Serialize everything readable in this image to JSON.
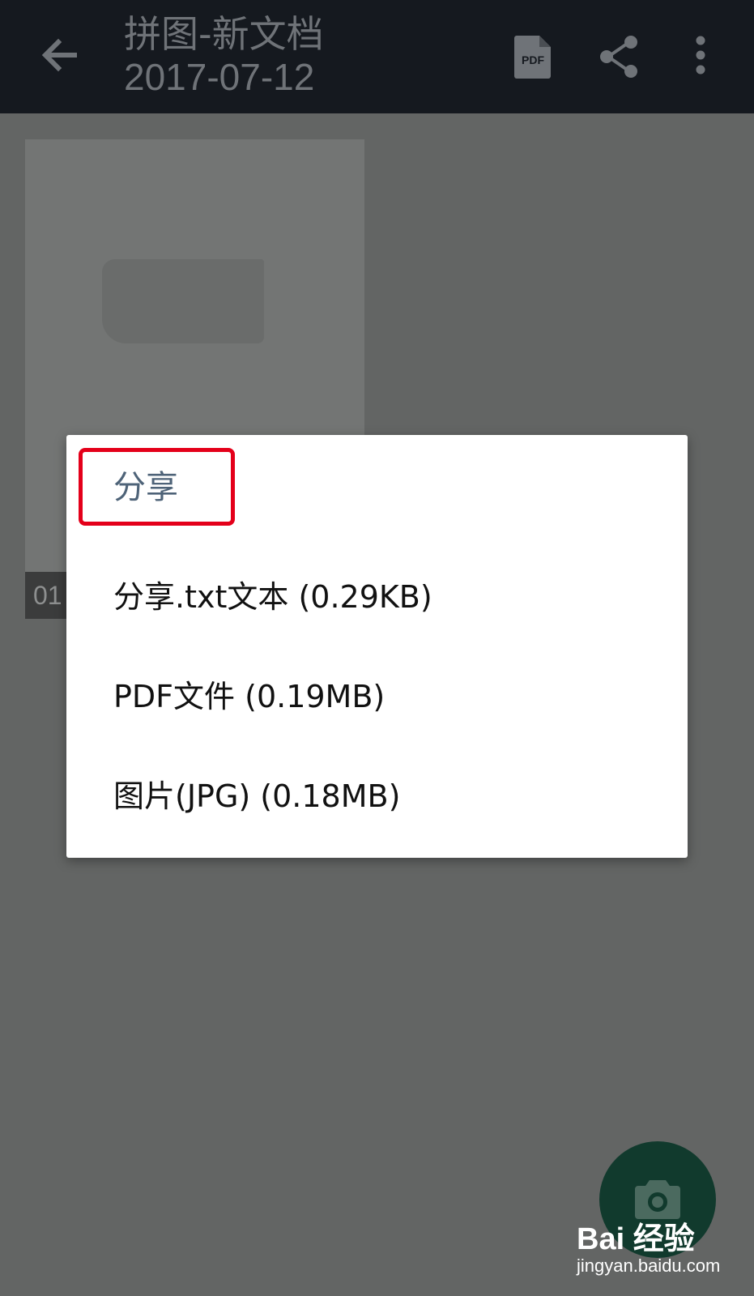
{
  "appbar": {
    "title": "拼图-新文档",
    "subtitle": "2017-07-12",
    "back_icon": "arrow-back-icon",
    "pdf_icon": "pdf-file-icon",
    "pdf_icon_text": "PDF",
    "share_icon": "share-icon",
    "more_icon": "more-vert-icon"
  },
  "page": {
    "number": "01"
  },
  "dialog": {
    "title": "分享",
    "options": [
      {
        "label": "分享.txt文本 (0.29KB)"
      },
      {
        "label": "PDF文件 (0.19MB)"
      },
      {
        "label": "图片(JPG) (0.18MB)"
      }
    ]
  },
  "fab": {
    "icon": "camera-icon"
  },
  "watermark": {
    "logo": "Bai 经验",
    "url": "jingyan.baidu.com"
  },
  "colors": {
    "appbar_bg": "#15191f",
    "scrim_bg": "#636564",
    "dialog_title": "#4e6378",
    "highlight": "#e4001a",
    "fab_bg": "#113a2d"
  }
}
